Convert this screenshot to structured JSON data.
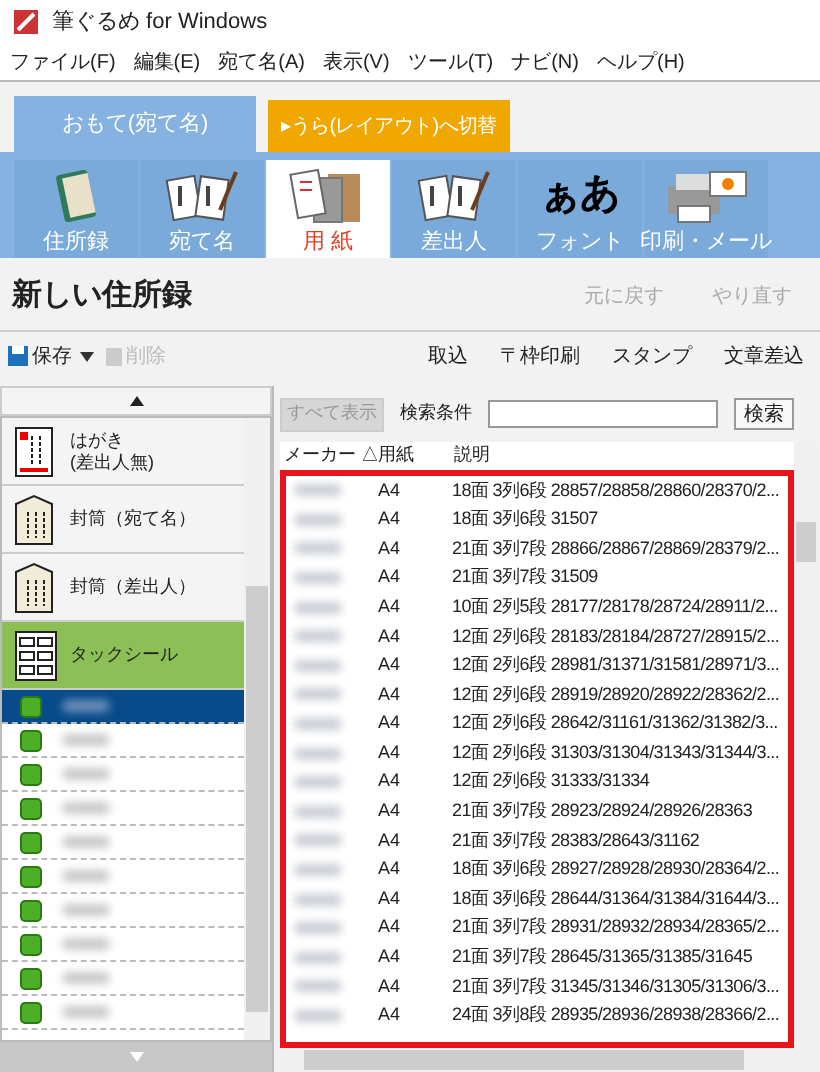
{
  "window": {
    "title": "筆ぐるめ for Windows"
  },
  "menu": [
    "ファイル(F)",
    "編集(E)",
    "宛て名(A)",
    "表示(V)",
    "ツール(T)",
    "ナビ(N)",
    "ヘルプ(H)"
  ],
  "side_tabs": [
    {
      "label": "おもて(宛て名)",
      "kind": "face",
      "selected": true
    },
    {
      "label": "▸うら(レイアウト)へ切替",
      "kind": "switch",
      "selected": false
    }
  ],
  "toolbar": [
    {
      "label": "住所録",
      "kind": "book",
      "selected": false
    },
    {
      "label": "宛て名",
      "kind": "cards",
      "selected": false
    },
    {
      "label": "用 紙",
      "kind": "paper",
      "selected": true
    },
    {
      "label": "差出人",
      "kind": "cards",
      "selected": false
    },
    {
      "label": "フォント",
      "kind": "font",
      "glyph": "ぁあ",
      "selected": false
    },
    {
      "label": "印刷・メール",
      "kind": "printer",
      "selected": false
    }
  ],
  "address_book": {
    "title": "新しい住所録",
    "undo": "元に戻す",
    "redo": "やり直す",
    "undo_disabled": true
  },
  "actions": {
    "save": "保存",
    "delete": "削除",
    "delete_disabled": true,
    "right": [
      "取込",
      "〒枠印刷",
      "スタンプ",
      "文章差込"
    ]
  },
  "paper_types": [
    {
      "label": "はがき\n(差出人無)",
      "kind": "postcard",
      "selected": false
    },
    {
      "label": "封筒（宛て名）",
      "kind": "envelope",
      "selected": false
    },
    {
      "label": "封筒（差出人）",
      "kind": "envelope",
      "selected": false
    },
    {
      "label": "タックシール",
      "kind": "label",
      "selected": true,
      "items": [
        {
          "selected": true
        },
        {
          "selected": false
        },
        {
          "selected": false
        },
        {
          "selected": false
        },
        {
          "selected": false
        },
        {
          "selected": false
        },
        {
          "selected": false
        },
        {
          "selected": false
        },
        {
          "selected": false
        },
        {
          "selected": false
        }
      ]
    }
  ],
  "search": {
    "show_all": "すべて表示",
    "show_all_disabled": true,
    "label": "検索条件",
    "button": "検索"
  },
  "table": {
    "columns": [
      "メーカー △",
      "用紙",
      "説明"
    ],
    "rows": [
      {
        "paper": "A4",
        "description": "18面 3列6段 28857/28858/28860/28370/2..."
      },
      {
        "paper": "A4",
        "description": "18面 3列6段 31507"
      },
      {
        "paper": "A4",
        "description": "21面 3列7段 28866/28867/28869/28379/2..."
      },
      {
        "paper": "A4",
        "description": "21面 3列7段 31509"
      },
      {
        "paper": "A4",
        "description": "10面 2列5段 28177/28178/28724/28911/2..."
      },
      {
        "paper": "A4",
        "description": "12面 2列6段 28183/28184/28727/28915/2..."
      },
      {
        "paper": "A4",
        "description": "12面 2列6段 28981/31371/31581/28971/3..."
      },
      {
        "paper": "A4",
        "description": "12面 2列6段 28919/28920/28922/28362/2..."
      },
      {
        "paper": "A4",
        "description": "12面 2列6段 28642/31161/31362/31382/3..."
      },
      {
        "paper": "A4",
        "description": "12面 2列6段 31303/31304/31343/31344/3..."
      },
      {
        "paper": "A4",
        "description": "12面 2列6段 31333/31334"
      },
      {
        "paper": "A4",
        "description": "21面 3列7段 28923/28924/28926/28363"
      },
      {
        "paper": "A4",
        "description": "21面 3列7段 28383/28643/31162"
      },
      {
        "paper": "A4",
        "description": "18面 3列6段 28927/28928/28930/28364/2..."
      },
      {
        "paper": "A4",
        "description": "18面 3列6段 28644/31364/31384/31644/3..."
      },
      {
        "paper": "A4",
        "description": "21面 3列7段 28931/28932/28934/28365/2..."
      },
      {
        "paper": "A4",
        "description": "21面 3列7段 28645/31365/31385/31645"
      },
      {
        "paper": "A4",
        "description": "21面 3列7段 31345/31346/31305/31306/3..."
      },
      {
        "paper": "A4",
        "description": "24面 3列8段 28935/28936/28938/28366/2..."
      }
    ]
  }
}
